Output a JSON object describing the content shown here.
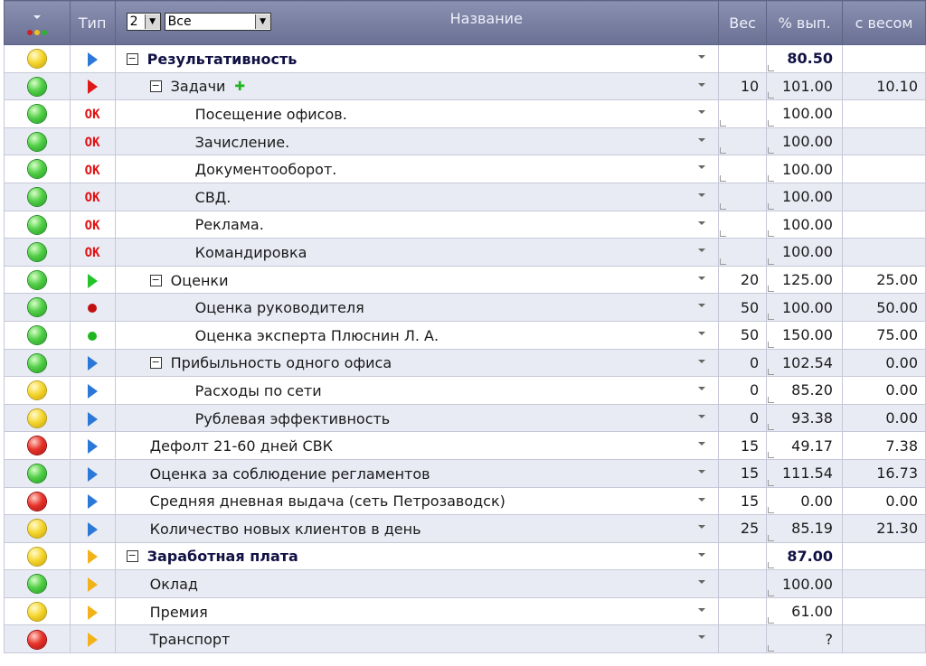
{
  "header": {
    "type_label": "Тип",
    "level_value": "2",
    "filter_value": "Все",
    "name_label": "Название",
    "ves_label": "Вес",
    "pct_label": "% вып.",
    "with_weight_label": "с весом",
    "status_dots": [
      "#d02020",
      "#f0c020",
      "#30b030"
    ]
  },
  "rows": [
    {
      "status": "yellow",
      "type": "tri-blue",
      "indent": 0,
      "toggle": "−",
      "name": "Результативность",
      "bold": true,
      "plus": false,
      "ves": "",
      "pct": "80.50",
      "pct_bold": true,
      "sw": "",
      "ves_corner": false,
      "pct_corner": true
    },
    {
      "status": "green",
      "type": "tri-red",
      "indent": 1,
      "toggle": "−",
      "name": "Задачи",
      "bold": false,
      "plus": true,
      "ves": "10",
      "pct": "101.00",
      "pct_bold": false,
      "sw": "10.10",
      "ves_corner": false,
      "pct_corner": true
    },
    {
      "status": "green",
      "type": "ok",
      "indent": 2,
      "toggle": "",
      "name": "Посещение офисов.",
      "bold": false,
      "plus": false,
      "ves": "",
      "pct": "100.00",
      "pct_bold": false,
      "sw": "",
      "ves_corner": true,
      "pct_corner": true
    },
    {
      "status": "green",
      "type": "ok",
      "indent": 2,
      "toggle": "",
      "name": "Зачисление.",
      "bold": false,
      "plus": false,
      "ves": "",
      "pct": "100.00",
      "pct_bold": false,
      "sw": "",
      "ves_corner": true,
      "pct_corner": true
    },
    {
      "status": "green",
      "type": "ok",
      "indent": 2,
      "toggle": "",
      "name": "Документооборот.",
      "bold": false,
      "plus": false,
      "ves": "",
      "pct": "100.00",
      "pct_bold": false,
      "sw": "",
      "ves_corner": true,
      "pct_corner": true
    },
    {
      "status": "green",
      "type": "ok",
      "indent": 2,
      "toggle": "",
      "name": "СВД.",
      "bold": false,
      "plus": false,
      "ves": "",
      "pct": "100.00",
      "pct_bold": false,
      "sw": "",
      "ves_corner": true,
      "pct_corner": true
    },
    {
      "status": "green",
      "type": "ok",
      "indent": 2,
      "toggle": "",
      "name": "Реклама.",
      "bold": false,
      "plus": false,
      "ves": "",
      "pct": "100.00",
      "pct_bold": false,
      "sw": "",
      "ves_corner": true,
      "pct_corner": true
    },
    {
      "status": "green",
      "type": "ok",
      "indent": 2,
      "toggle": "",
      "name": "Командировка",
      "bold": false,
      "plus": false,
      "ves": "",
      "pct": "100.00",
      "pct_bold": false,
      "sw": "",
      "ves_corner": true,
      "pct_corner": true
    },
    {
      "status": "green",
      "type": "tri-green",
      "indent": 1,
      "toggle": "−",
      "name": "Оценки",
      "bold": false,
      "plus": false,
      "ves": "20",
      "pct": "125.00",
      "pct_bold": false,
      "sw": "25.00",
      "ves_corner": false,
      "pct_corner": true
    },
    {
      "status": "green",
      "type": "dot-red",
      "indent": 2,
      "toggle": "",
      "name": "Оценка руководителя",
      "bold": false,
      "plus": false,
      "ves": "50",
      "pct": "100.00",
      "pct_bold": false,
      "sw": "50.00",
      "ves_corner": false,
      "pct_corner": true
    },
    {
      "status": "green",
      "type": "dot-green",
      "indent": 2,
      "toggle": "",
      "name": "Оценка эксперта Плюснин Л. А.",
      "bold": false,
      "plus": false,
      "ves": "50",
      "pct": "150.00",
      "pct_bold": false,
      "sw": "75.00",
      "ves_corner": false,
      "pct_corner": true
    },
    {
      "status": "green",
      "type": "tri-blue",
      "indent": 1,
      "toggle": "−",
      "name": "Прибыльность одного офиса",
      "bold": false,
      "plus": false,
      "ves": "0",
      "pct": "102.54",
      "pct_bold": false,
      "sw": "0.00",
      "ves_corner": false,
      "pct_corner": true
    },
    {
      "status": "yellow",
      "type": "tri-blue",
      "indent": 2,
      "toggle": "",
      "name": "Расходы по сети",
      "bold": false,
      "plus": false,
      "ves": "0",
      "pct": "85.20",
      "pct_bold": false,
      "sw": "0.00",
      "ves_corner": false,
      "pct_corner": true
    },
    {
      "status": "yellow",
      "type": "tri-blue",
      "indent": 2,
      "toggle": "",
      "name": "Рублевая эффективность",
      "bold": false,
      "plus": false,
      "ves": "0",
      "pct": "93.38",
      "pct_bold": false,
      "sw": "0.00",
      "ves_corner": false,
      "pct_corner": true
    },
    {
      "status": "red",
      "type": "tri-blue",
      "indent": 1,
      "toggle": "",
      "name": "Дефолт 21-60 дней СВК",
      "bold": false,
      "plus": false,
      "ves": "15",
      "pct": "49.17",
      "pct_bold": false,
      "sw": "7.38",
      "ves_corner": false,
      "pct_corner": true
    },
    {
      "status": "green",
      "type": "tri-blue",
      "indent": 1,
      "toggle": "",
      "name": "Оценка за соблюдение регламентов",
      "bold": false,
      "plus": false,
      "ves": "15",
      "pct": "111.54",
      "pct_bold": false,
      "sw": "16.73",
      "ves_corner": false,
      "pct_corner": true
    },
    {
      "status": "red",
      "type": "tri-blue",
      "indent": 1,
      "toggle": "",
      "name": "Средняя дневная выдача (сеть Петрозаводск)",
      "bold": false,
      "plus": false,
      "ves": "15",
      "pct": "0.00",
      "pct_bold": false,
      "sw": "0.00",
      "ves_corner": false,
      "pct_corner": true
    },
    {
      "status": "yellow",
      "type": "tri-blue",
      "indent": 1,
      "toggle": "",
      "name": "Количество новых клиентов в день",
      "bold": false,
      "plus": false,
      "ves": "25",
      "pct": "85.19",
      "pct_bold": false,
      "sw": "21.30",
      "ves_corner": false,
      "pct_corner": true
    },
    {
      "status": "yellow",
      "type": "tri-orange",
      "indent": 0,
      "toggle": "−",
      "name": "Заработная плата",
      "bold": true,
      "plus": false,
      "ves": "",
      "pct": "87.00",
      "pct_bold": true,
      "sw": "",
      "ves_corner": false,
      "pct_corner": true
    },
    {
      "status": "green",
      "type": "tri-orange",
      "indent": 1,
      "toggle": "",
      "name": "Оклад",
      "bold": false,
      "plus": false,
      "ves": "",
      "pct": "100.00",
      "pct_bold": false,
      "sw": "",
      "ves_corner": false,
      "pct_corner": true
    },
    {
      "status": "yellow",
      "type": "tri-orange",
      "indent": 1,
      "toggle": "",
      "name": "Премия",
      "bold": false,
      "plus": false,
      "ves": "",
      "pct": "61.00",
      "pct_bold": false,
      "sw": "",
      "ves_corner": false,
      "pct_corner": true
    },
    {
      "status": "red",
      "type": "tri-orange",
      "indent": 1,
      "toggle": "",
      "name": "Транспорт",
      "bold": false,
      "plus": false,
      "ves": "",
      "pct": "?",
      "pct_bold": false,
      "sw": "",
      "ves_corner": false,
      "pct_corner": true
    }
  ]
}
